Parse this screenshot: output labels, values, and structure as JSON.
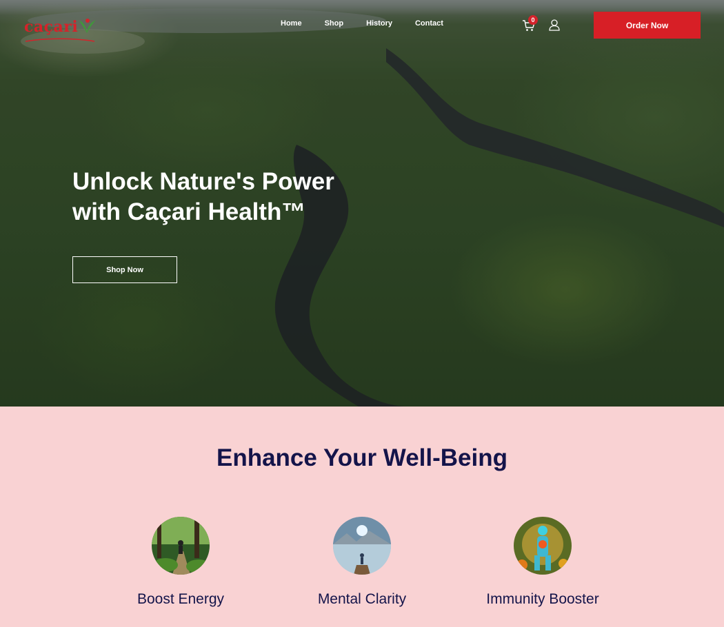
{
  "brand": {
    "logo_text": "caçari",
    "color": "#d4232b"
  },
  "nav": {
    "items": [
      {
        "label": "Home"
      },
      {
        "label": "Shop"
      },
      {
        "label": "History"
      },
      {
        "label": "Contact"
      }
    ],
    "cart_count": "0",
    "cart_icon": "cart-icon",
    "user_icon": "user-icon",
    "order_button": "Order Now"
  },
  "hero": {
    "title_line1": "Unlock Nature's Power",
    "title_line2": "with Caçari Health™",
    "cta": "Shop Now"
  },
  "benefits": {
    "title": "Enhance Your Well-Being",
    "items": [
      {
        "label": "Boost Energy",
        "image": "forest-runner-image"
      },
      {
        "label": "Mental Clarity",
        "image": "meditation-lake-image"
      },
      {
        "label": "Immunity Booster",
        "image": "glowing-body-image"
      }
    ]
  },
  "colors": {
    "accent_red": "#d71f26",
    "section_bg": "#f9d2d3",
    "heading_navy": "#14144a"
  }
}
